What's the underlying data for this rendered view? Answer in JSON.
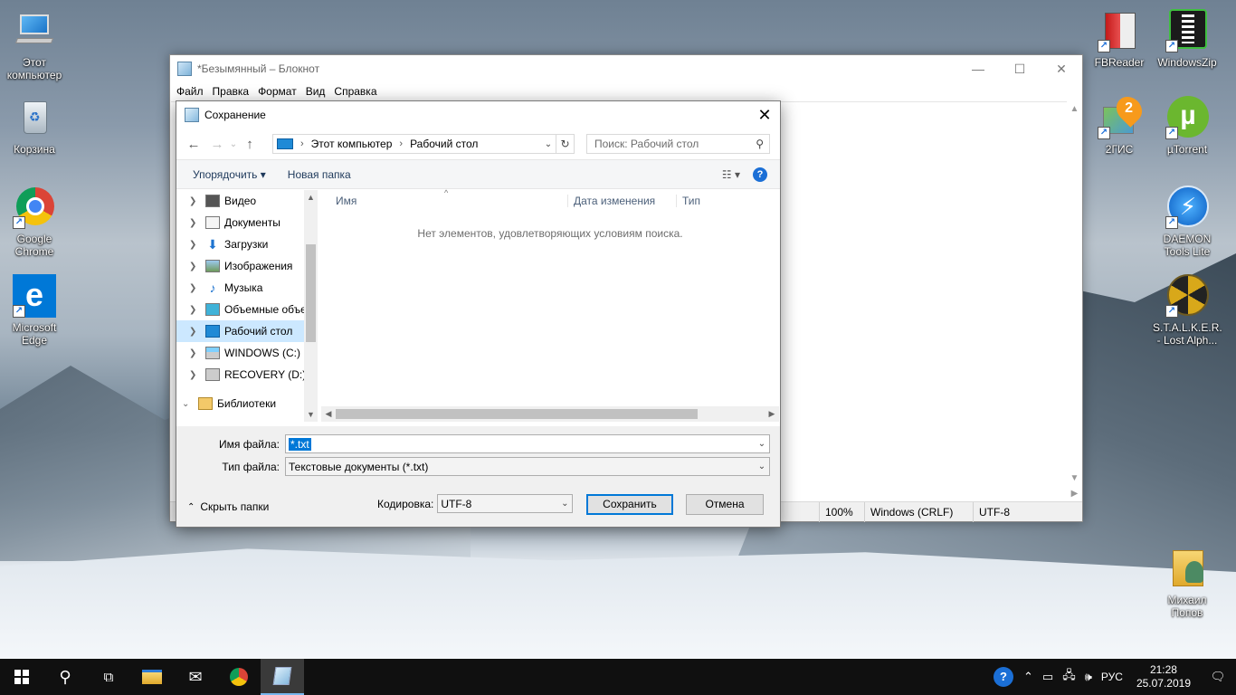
{
  "desktop": {
    "icons_left": [
      {
        "label": "Этот компьютер",
        "icon": "computer-icon"
      },
      {
        "label": "Корзина",
        "icon": "recycle-bin-icon"
      },
      {
        "label": "Google Chrome",
        "icon": "chrome-icon"
      },
      {
        "label": "Microsoft Edge",
        "icon": "edge-icon"
      }
    ],
    "icons_right": [
      {
        "label": "FBReader",
        "icon": "fbreader-icon"
      },
      {
        "label": "WindowsZip",
        "icon": "windowszip-icon"
      },
      {
        "label": "2ГИС",
        "icon": "2gis-icon"
      },
      {
        "label": "µTorrent",
        "icon": "utorrent-icon"
      },
      {
        "label": "DAEMON Tools Lite",
        "icon": "daemon-tools-icon"
      },
      {
        "label": "S.T.A.L.K.E.R. - Lost Alph...",
        "icon": "stalker-icon"
      },
      {
        "label": "Михаил Попов",
        "icon": "user-folder-icon"
      }
    ]
  },
  "notepad": {
    "title": "*Безымянный – Блокнот",
    "menu": [
      "Файл",
      "Правка",
      "Формат",
      "Вид",
      "Справка"
    ],
    "status": {
      "zoom": "100%",
      "line_endings": "Windows (CRLF)",
      "encoding": "UTF-8"
    }
  },
  "dialog": {
    "title": "Сохранение",
    "address": {
      "root": "Этот компьютер",
      "current": "Рабочий стол"
    },
    "search_placeholder": "Поиск: Рабочий стол",
    "toolbar": {
      "organize": "Упорядочить",
      "new_folder": "Новая папка"
    },
    "nav_items": [
      {
        "label": "Видео",
        "icon": "video-folder-icon"
      },
      {
        "label": "Документы",
        "icon": "documents-folder-icon"
      },
      {
        "label": "Загрузки",
        "icon": "downloads-folder-icon"
      },
      {
        "label": "Изображения",
        "icon": "pictures-folder-icon"
      },
      {
        "label": "Музыка",
        "icon": "music-folder-icon"
      },
      {
        "label": "Объемные объе",
        "icon": "3d-objects-folder-icon"
      },
      {
        "label": "Рабочий стол",
        "icon": "desktop-folder-icon"
      },
      {
        "label": "WINDOWS (C:)",
        "icon": "drive-c-icon"
      },
      {
        "label": "RECOVERY (D:)",
        "icon": "drive-d-icon"
      },
      {
        "label": "Библиотеки",
        "icon": "libraries-icon"
      }
    ],
    "columns": {
      "name": "Имя",
      "date": "Дата изменения",
      "type": "Тип"
    },
    "empty_message": "Нет элементов, удовлетворяющих условиям поиска.",
    "filename_label": "Имя файла:",
    "filename_value": "*.txt",
    "filetype_label": "Тип файла:",
    "filetype_value": "Текстовые документы (*.txt)",
    "hide_folders": "Скрыть папки",
    "encoding_label": "Кодировка:",
    "encoding_value": "UTF-8",
    "save_button": "Сохранить",
    "cancel_button": "Отмена"
  },
  "taskbar": {
    "language": "РУС",
    "time": "21:28",
    "date": "25.07.2019"
  }
}
